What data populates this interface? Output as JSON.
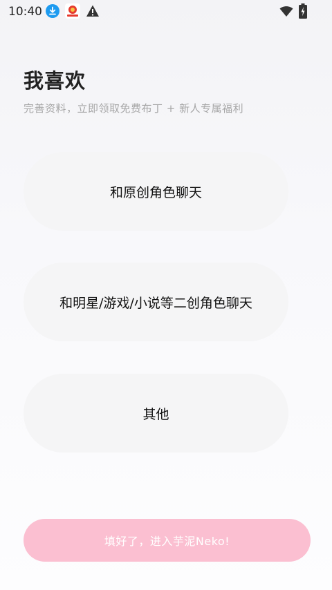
{
  "status_bar": {
    "time": "10:40",
    "icons": [
      "download-icon",
      "app-icon",
      "warning-icon",
      "wifi-icon",
      "battery-icon"
    ]
  },
  "header": {
    "title": "我喜欢",
    "subtitle": "完善资料，立即领取免费布丁 + 新人专属福利"
  },
  "options": [
    {
      "label": "和原创角色聊天"
    },
    {
      "label": "和明星/游戏/小说等二创角色聊天"
    },
    {
      "label": "其他"
    }
  ],
  "submit": {
    "label": "填好了，进入芋泥Neko!"
  },
  "colors": {
    "submit_bg": "#fbbfd1",
    "option_bg": "#f5f5f6",
    "subtitle": "#a6a6a6",
    "download_icon": "#1e9bf0"
  }
}
